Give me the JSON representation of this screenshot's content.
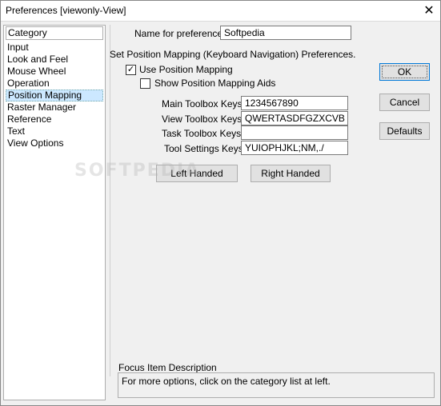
{
  "window": {
    "title": "Preferences [viewonly-View]",
    "close_glyph": "✕"
  },
  "categories": {
    "header": "Category",
    "items": [
      "Input",
      "Look and Feel",
      "Mouse Wheel",
      "Operation",
      "Position Mapping",
      "Raster Manager",
      "Reference",
      "Text",
      "View Options"
    ],
    "selected": "Position Mapping"
  },
  "main": {
    "name_label": "Name for preferences",
    "name_value": "Softpedia",
    "heading": "Set Position Mapping (Keyboard Navigation) Preferences.",
    "use_position_mapping": {
      "label": "Use Position Mapping",
      "checked": true,
      "check_glyph": "✓"
    },
    "show_aids": {
      "label": "Show Position Mapping Aids",
      "checked": false
    },
    "keys": [
      {
        "label": "Main Toolbox Keys:",
        "value": "1234567890"
      },
      {
        "label": "View Toolbox Keys:",
        "value": "QWERTASDFGZXCVB"
      },
      {
        "label": "Task Toolbox Keys:",
        "value": ""
      },
      {
        "label": "Tool Settings Keys:",
        "value": "YUIOPHJKL;NM,./"
      }
    ],
    "left_handed": "Left Handed",
    "right_handed": "Right Handed",
    "focus_title": "Focus Item Description",
    "focus_text": "For more options, click on the category list at left."
  },
  "buttons": {
    "ok": "OK",
    "cancel": "Cancel",
    "defaults": "Defaults"
  },
  "watermark": "SOFTPEDIA"
}
